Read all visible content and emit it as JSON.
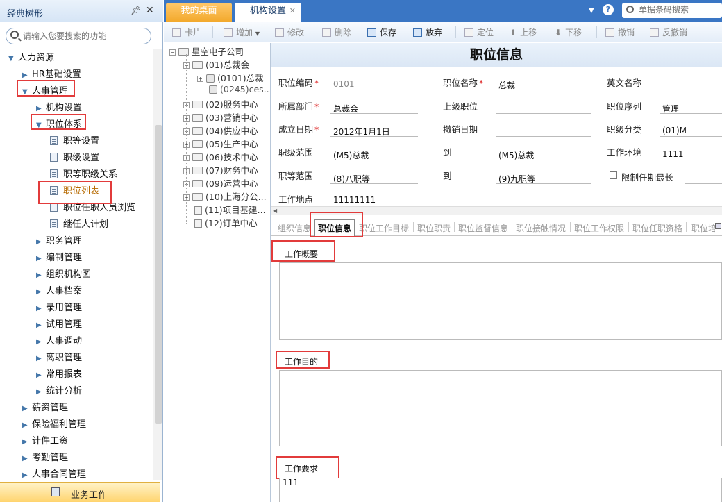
{
  "left_panel": {
    "title": "经典树形",
    "search_placeholder": "请输入您要搜索的功能",
    "items": [
      {
        "label": "人力资源",
        "level": 0,
        "expanded": true
      },
      {
        "label": "HR基础设置",
        "level": 1,
        "expanded": false
      },
      {
        "label": "人事管理",
        "level": 1,
        "expanded": true,
        "highlighted": true
      },
      {
        "label": "机构设置",
        "level": 2,
        "expanded": false
      },
      {
        "label": "职位体系",
        "level": 2,
        "expanded": true,
        "highlighted": true
      },
      {
        "label": "职等设置",
        "level": 3
      },
      {
        "label": "职级设置",
        "level": 3
      },
      {
        "label": "职等职级关系",
        "level": 3
      },
      {
        "label": "职位列表",
        "level": 3,
        "selected": true,
        "highlighted": true
      },
      {
        "label": "职位任职人员浏览",
        "level": 3
      },
      {
        "label": "继任人计划",
        "level": 3
      },
      {
        "label": "职务管理",
        "level": 2
      },
      {
        "label": "编制管理",
        "level": 2
      },
      {
        "label": "组织机构图",
        "level": 2
      },
      {
        "label": "人事档案",
        "level": 2
      },
      {
        "label": "录用管理",
        "level": 2
      },
      {
        "label": "试用管理",
        "level": 2
      },
      {
        "label": "人事调动",
        "level": 2
      },
      {
        "label": "离职管理",
        "level": 2
      },
      {
        "label": "常用报表",
        "level": 2
      },
      {
        "label": "统计分析",
        "level": 2
      },
      {
        "label": "薪资管理",
        "level": 1
      },
      {
        "label": "保险福利管理",
        "level": 1
      },
      {
        "label": "计件工资",
        "level": 1
      },
      {
        "label": "考勤管理",
        "level": 1
      },
      {
        "label": "人事合同管理",
        "level": 1
      }
    ],
    "bottom_label": "业务工作"
  },
  "tabs": {
    "desktop": "我的桌面",
    "org_settings": "机构设置",
    "close_symbol": "✕"
  },
  "search": {
    "placeholder": "单据条码搜索"
  },
  "help_symbol": "?",
  "toolbar": {
    "card": "卡片",
    "add": "增加",
    "modify": "修改",
    "delete": "删除",
    "save": "保存",
    "discard": "放弃",
    "locate": "定位",
    "move_up": "上移",
    "move_down": "下移",
    "revoke": "撤销",
    "unrevoke": "反撤销"
  },
  "org_tree": {
    "root": "星空电子公司",
    "nodes": [
      "(01)总裁会",
      "(0101)总裁",
      "(0245)ces...",
      "(02)服务中心",
      "(03)营销中心",
      "(04)供应中心",
      "(05)生产中心",
      "(06)技术中心",
      "(07)财务中心",
      "(09)运营中心",
      "(10)上海分公...",
      "(11)项目基建...",
      "(12)订单中心"
    ]
  },
  "form": {
    "title": "职位信息",
    "fields": {
      "code_label": "职位编码",
      "code_value": "0101",
      "name_label": "职位名称",
      "name_value": "总裁",
      "en_label": "英文名称",
      "en_value": "",
      "dept_label": "所属部门",
      "dept_value": "总裁会",
      "parent_label": "上级职位",
      "parent_value": "",
      "seq_label": "职位序列",
      "seq_value": "管理",
      "est_label": "成立日期",
      "est_value": "2012年1月1日",
      "cancel_label": "撤销日期",
      "cancel_value": "",
      "class_label": "职级分类",
      "class_value": "(01)M",
      "range_label": "职级范围",
      "range_from": "(M5)总裁",
      "to_label": "到",
      "range_to": "(M5)总裁",
      "env_label": "工作环境",
      "env_value": "1111",
      "grade_label": "职等范围",
      "grade_from": "(8)八职等",
      "grade_to": "(9)九职等",
      "limit_label": "限制任期最长",
      "place_label": "工作地点",
      "place_value": "11111111"
    },
    "required_mark": "*"
  },
  "subtabs": [
    "组织信息",
    "职位信息",
    "职位工作目标",
    "职位职责",
    "职位监督信息",
    "职位接触情况",
    "职位工作权限",
    "职位任职资格",
    "职位培"
  ],
  "sections": {
    "summary_label": "工作概要",
    "summary_value": "",
    "purpose_label": "工作目的",
    "purpose_value": "",
    "req_label": "工作要求",
    "req_value": "111"
  },
  "colors": {
    "accent_blue": "#3a76c4",
    "highlight_red": "#e23b3b",
    "desktop_tab": "#f2a82a",
    "selected_text": "#b66a00"
  }
}
